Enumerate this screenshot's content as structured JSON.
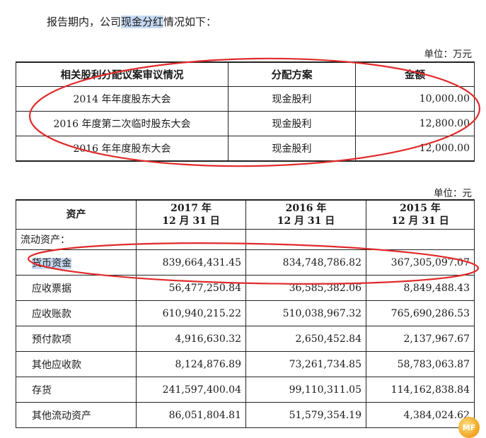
{
  "intro": {
    "before": "报告期内，公司",
    "highlight": "现金分红",
    "after": "情况如下："
  },
  "dividend_table": {
    "unit": "单位：万元",
    "headers": [
      "相关股利分配议案审议情况",
      "分配方案",
      "金额"
    ],
    "rows": [
      [
        "2014 年年度股东大会",
        "现金股利",
        "10,000.00"
      ],
      [
        "2016 年度第二次临时股东大会",
        "现金股利",
        "12,800.00"
      ],
      [
        "2016 年年度股东大会",
        "现金股利",
        "12,000.00"
      ]
    ]
  },
  "asset_table": {
    "unit": "单位：元",
    "headers": {
      "asset": "资产",
      "years": [
        {
          "year": "2017 年",
          "date": "12 月 31 日"
        },
        {
          "year": "2016 年",
          "date": "12 月 31 日"
        },
        {
          "year": "2015 年",
          "date": "12 月 31 日"
        }
      ]
    },
    "section": "流动资产：",
    "rows": [
      {
        "name": "货币资金",
        "values": [
          "839,664,431.45",
          "834,748,786.82",
          "367,305,097.07"
        ]
      },
      {
        "name": "应收票据",
        "values": [
          "56,477,250.84",
          "36,585,382.06",
          "8,849,488.43"
        ]
      },
      {
        "name": "应收账款",
        "values": [
          "610,940,215.22",
          "510,038,967.32",
          "765,690,286.53"
        ]
      },
      {
        "name": "预付款项",
        "values": [
          "4,916,630.32",
          "2,650,452.84",
          "2,137,967.67"
        ]
      },
      {
        "name": "其他应收款",
        "values": [
          "8,124,876.89",
          "73,261,734.85",
          "58,783,063.87"
        ]
      },
      {
        "name": "存货",
        "values": [
          "241,597,400.04",
          "99,110,311.05",
          "114,162,838.84"
        ]
      },
      {
        "name": "其他流动资产",
        "values": [
          "86,051,804.81",
          "51,579,354.19",
          "4,384,024.62"
        ]
      }
    ]
  },
  "colors": {
    "annotation": "#e02a2a",
    "highlight": "#c5d9f1"
  },
  "logo_text": "MF"
}
